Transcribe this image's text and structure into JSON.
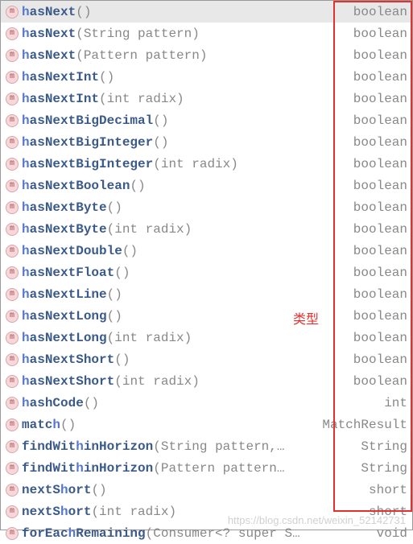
{
  "icon_letter": "m",
  "annotation_label": "类型",
  "watermark": "https://blog.csdn.net/weixin_52142731",
  "items": [
    {
      "pre": "",
      "hl": "h",
      "name": "asNext",
      "params": "()",
      "ret": "boolean",
      "selected": true
    },
    {
      "pre": "",
      "hl": "h",
      "name": "asNext",
      "params": "(String pattern)",
      "ret": "boolean",
      "selected": false
    },
    {
      "pre": "",
      "hl": "h",
      "name": "asNext",
      "params": "(Pattern pattern)",
      "ret": "boolean",
      "selected": false
    },
    {
      "pre": "",
      "hl": "h",
      "name": "asNextInt",
      "params": "()",
      "ret": "boolean",
      "selected": false
    },
    {
      "pre": "",
      "hl": "h",
      "name": "asNextInt",
      "params": "(int radix)",
      "ret": "boolean",
      "selected": false
    },
    {
      "pre": "",
      "hl": "h",
      "name": "asNextBigDecimal",
      "params": "()",
      "ret": "boolean",
      "selected": false
    },
    {
      "pre": "",
      "hl": "h",
      "name": "asNextBigInteger",
      "params": "()",
      "ret": "boolean",
      "selected": false
    },
    {
      "pre": "",
      "hl": "h",
      "name": "asNextBigInteger",
      "params": "(int radix)",
      "ret": "boolean",
      "selected": false
    },
    {
      "pre": "",
      "hl": "h",
      "name": "asNextBoolean",
      "params": "()",
      "ret": "boolean",
      "selected": false
    },
    {
      "pre": "",
      "hl": "h",
      "name": "asNextByte",
      "params": "()",
      "ret": "boolean",
      "selected": false
    },
    {
      "pre": "",
      "hl": "h",
      "name": "asNextByte",
      "params": "(int radix)",
      "ret": "boolean",
      "selected": false
    },
    {
      "pre": "",
      "hl": "h",
      "name": "asNextDouble",
      "params": "()",
      "ret": "boolean",
      "selected": false
    },
    {
      "pre": "",
      "hl": "h",
      "name": "asNextFloat",
      "params": "()",
      "ret": "boolean",
      "selected": false
    },
    {
      "pre": "",
      "hl": "h",
      "name": "asNextLine",
      "params": "()",
      "ret": "boolean",
      "selected": false
    },
    {
      "pre": "",
      "hl": "h",
      "name": "asNextLong",
      "params": "()",
      "ret": "boolean",
      "selected": false
    },
    {
      "pre": "",
      "hl": "h",
      "name": "asNextLong",
      "params": "(int radix)",
      "ret": "boolean",
      "selected": false
    },
    {
      "pre": "",
      "hl": "h",
      "name": "asNextShort",
      "params": "()",
      "ret": "boolean",
      "selected": false
    },
    {
      "pre": "",
      "hl": "h",
      "name": "asNextShort",
      "params": "(int radix)",
      "ret": "boolean",
      "selected": false
    },
    {
      "pre": "",
      "hl": "h",
      "name": "ashCode",
      "params": "()",
      "ret": "int",
      "selected": false
    },
    {
      "pre": "matc",
      "hl": "h",
      "name": "",
      "params": "()",
      "ret": "MatchResult",
      "selected": false
    },
    {
      "pre": "findWit",
      "hl": "h",
      "name": "inHorizon",
      "params": "(String pattern,…",
      "ret": "String",
      "selected": false
    },
    {
      "pre": "findWit",
      "hl": "h",
      "name": "inHorizon",
      "params": "(Pattern pattern…",
      "ret": "String",
      "selected": false
    },
    {
      "pre": "nextS",
      "hl": "h",
      "name": "ort",
      "params": "()",
      "ret": "short",
      "selected": false
    },
    {
      "pre": "nextS",
      "hl": "h",
      "name": "ort",
      "params": "(int radix)",
      "ret": "short",
      "selected": false
    },
    {
      "pre": "forEac",
      "hl": "h",
      "name": "Remaining",
      "params": "(Consumer<? super S…",
      "ret": "void",
      "selected": false
    }
  ]
}
